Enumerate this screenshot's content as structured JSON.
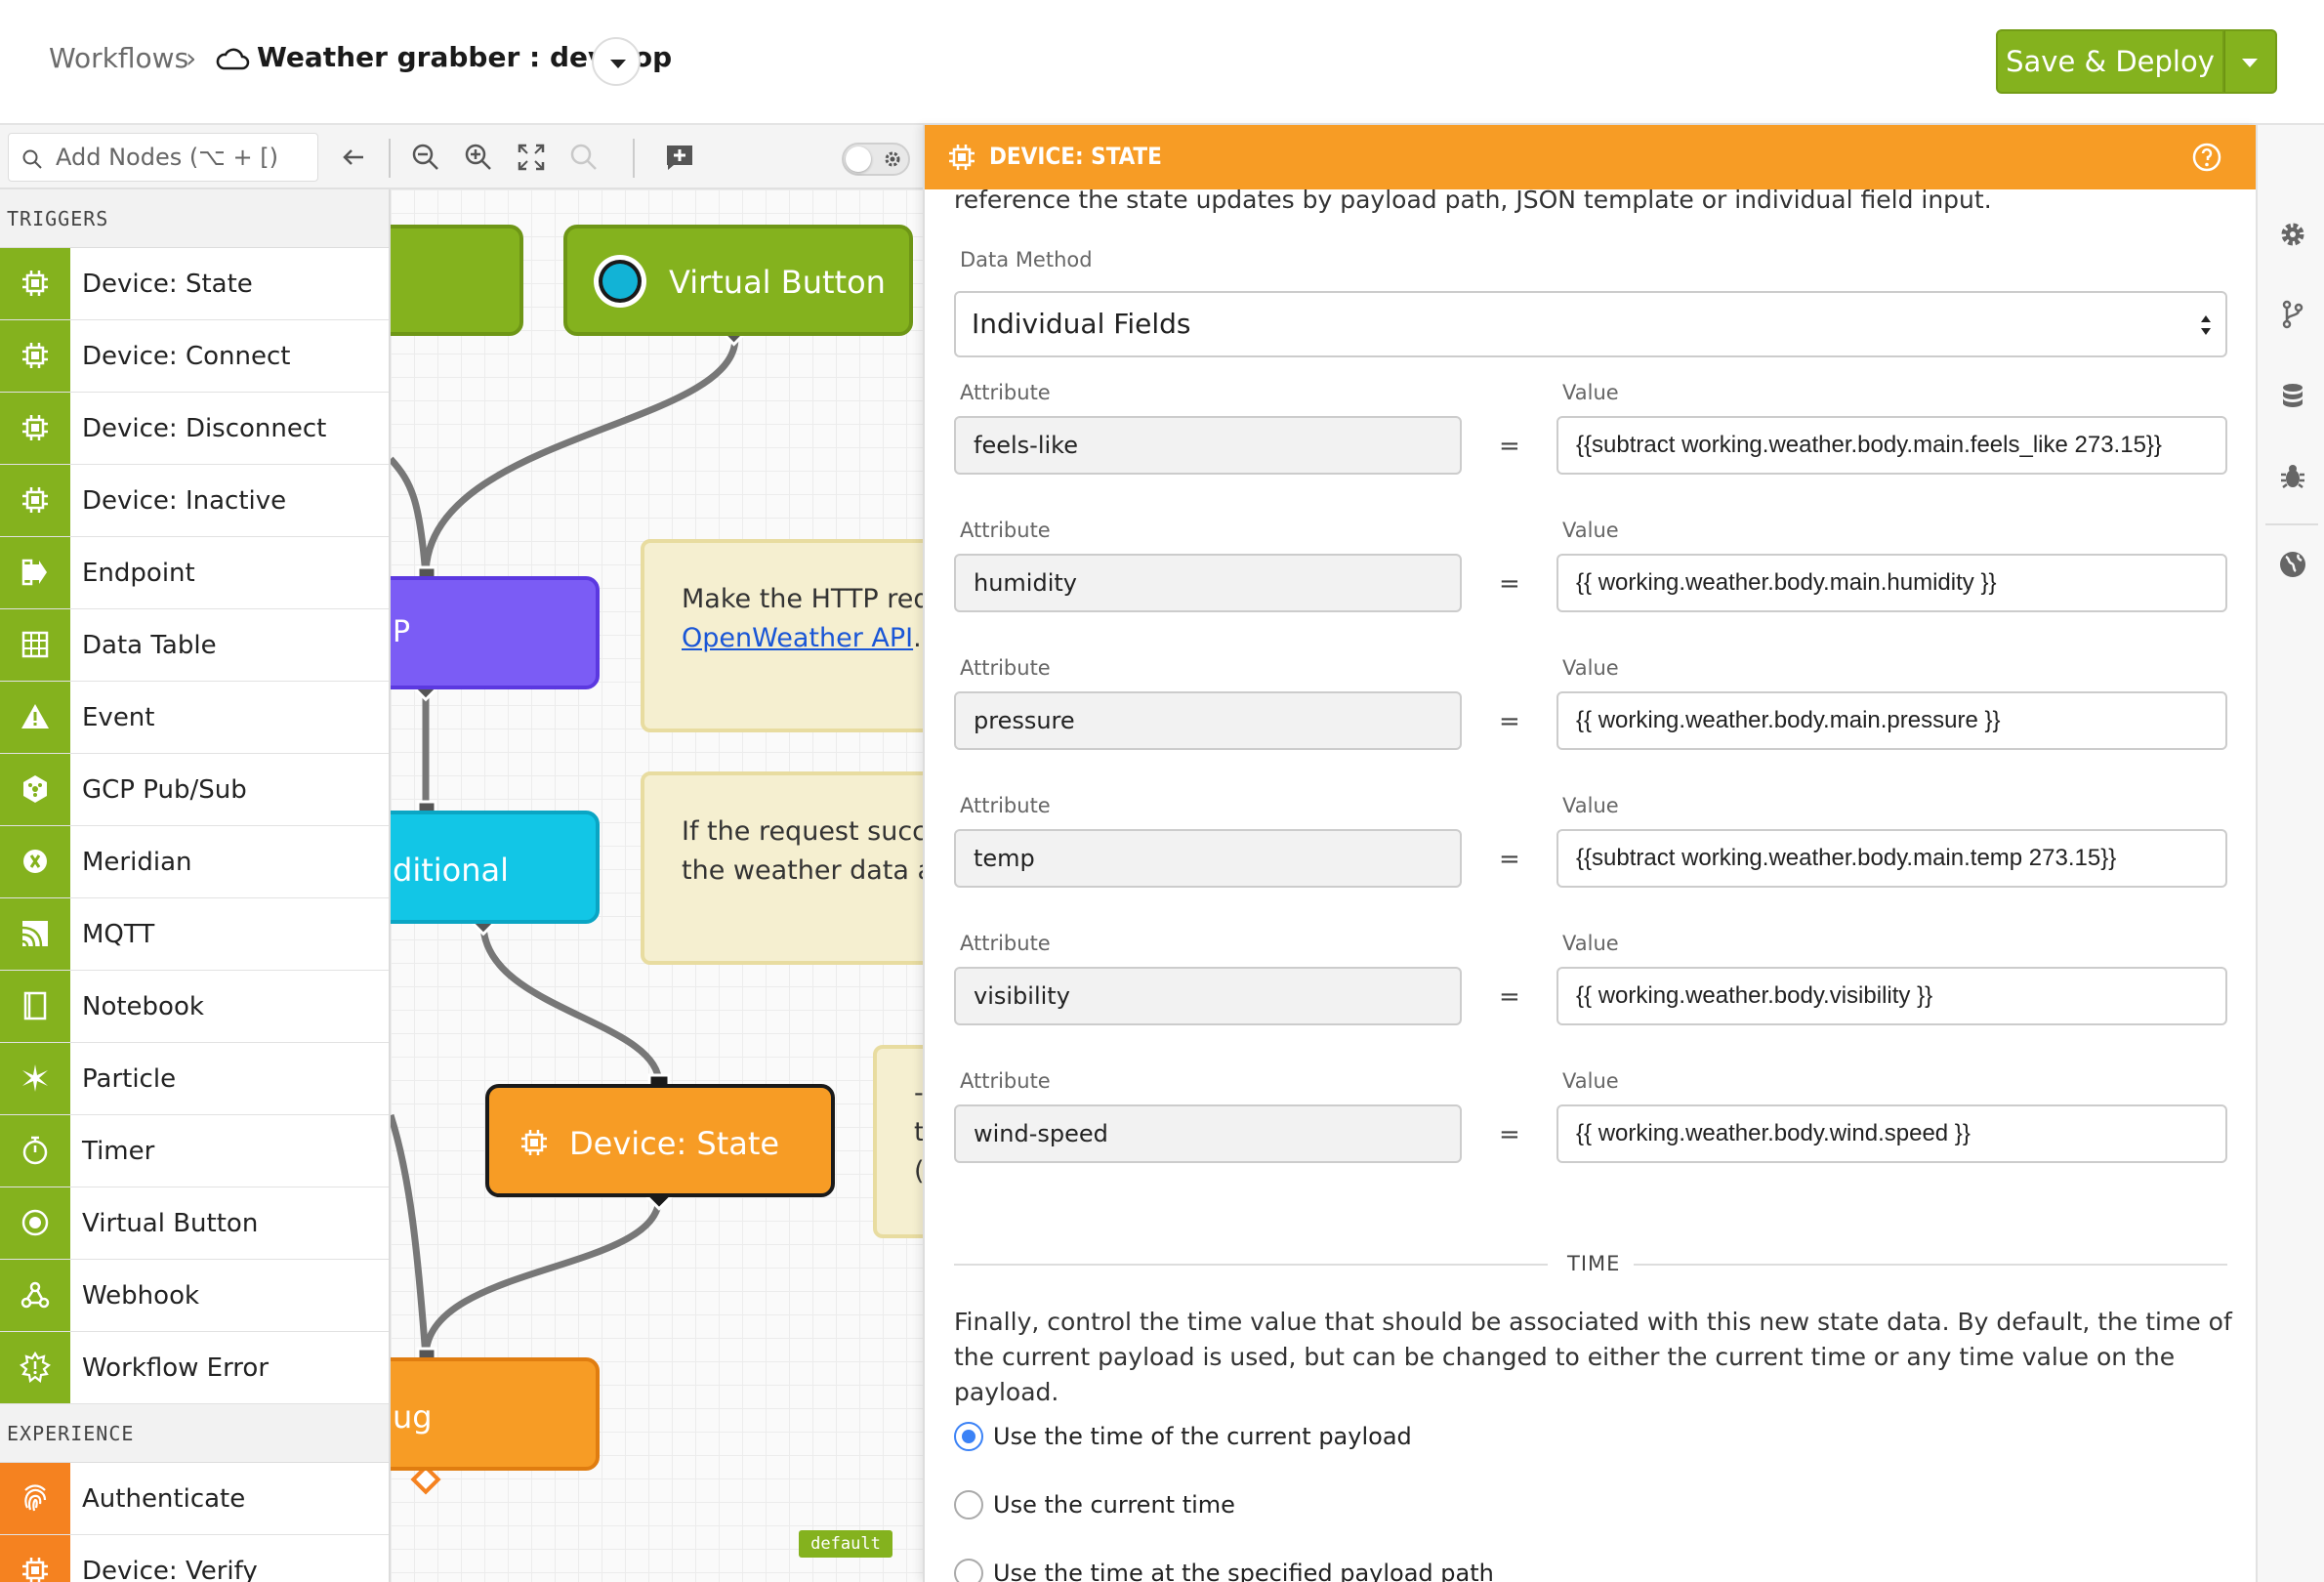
{
  "header": {
    "breadcrumb_root": "Workflows",
    "breadcrumb_sep": "›",
    "workflow_title": "Weather grabber : develop",
    "deploy_label": "Save & Deploy"
  },
  "toolbar": {
    "search_placeholder": "Add Nodes (⌥ + [)"
  },
  "sidebar": {
    "triggers_heading": "TRIGGERS",
    "triggers": [
      {
        "label": "Device: State",
        "icon": "device-chip-icon"
      },
      {
        "label": "Device: Connect",
        "icon": "device-chip-icon"
      },
      {
        "label": "Device: Disconnect",
        "icon": "device-chip-icon"
      },
      {
        "label": "Device: Inactive",
        "icon": "device-chip-icon"
      },
      {
        "label": "Endpoint",
        "icon": "endpoint-icon"
      },
      {
        "label": "Data Table",
        "icon": "table-icon"
      },
      {
        "label": "Event",
        "icon": "warning-icon"
      },
      {
        "label": "GCP Pub/Sub",
        "icon": "hexagon-icon"
      },
      {
        "label": "Meridian",
        "icon": "meridian-icon"
      },
      {
        "label": "MQTT",
        "icon": "mqtt-icon"
      },
      {
        "label": "Notebook",
        "icon": "notebook-icon"
      },
      {
        "label": "Particle",
        "icon": "particle-icon"
      },
      {
        "label": "Timer",
        "icon": "stopwatch-icon"
      },
      {
        "label": "Virtual Button",
        "icon": "target-icon"
      },
      {
        "label": "Webhook",
        "icon": "webhook-icon"
      },
      {
        "label": "Workflow Error",
        "icon": "error-gear-icon"
      }
    ],
    "experience_heading": "EXPERIENCE",
    "experience": [
      {
        "label": "Authenticate",
        "icon": "fingerprint-icon"
      },
      {
        "label": "Device: Verify",
        "icon": "device-chip-icon"
      }
    ]
  },
  "canvas": {
    "virtual_button_label": "Virtual Button",
    "http_node_fragment": "P",
    "conditional_fragment": "ditional",
    "device_state_label": "Device: State",
    "debug_fragment": "ug",
    "note1_line1": "Make the HTTP requ",
    "note1_link": "OpenWeather API",
    "note1_after": ".",
    "note2_line1": "If the request succe",
    "note2_line2": "the weather data as",
    "note3_line1": "-",
    "note3_line2": "t",
    "note3_line3": "(",
    "default_badge": "default"
  },
  "panel": {
    "title": "DEVICE: STATE",
    "intro_text": "reference the state updates by payload path, JSON template or individual field input.",
    "data_method_label": "Data Method",
    "data_method_value": "Individual Fields",
    "attribute_label": "Attribute",
    "value_label": "Value",
    "equals": "=",
    "fields": [
      {
        "attribute": "feels-like",
        "value": "{{subtract working.weather.body.main.feels_like 273.15}}"
      },
      {
        "attribute": "humidity",
        "value": "{{ working.weather.body.main.humidity }}"
      },
      {
        "attribute": "pressure",
        "value": "{{ working.weather.body.main.pressure }}"
      },
      {
        "attribute": "temp",
        "value": "{{subtract working.weather.body.main.temp 273.15}}"
      },
      {
        "attribute": "visibility",
        "value": "{{ working.weather.body.visibility }}"
      },
      {
        "attribute": "wind-speed",
        "value": "{{ working.weather.body.wind.speed }}"
      }
    ],
    "time_heading": "TIME",
    "time_description": "Finally, control the time value that should be associated with this new state data. By default, the time of the current payload is used, but can be changed to either the current time or any time value on the payload.",
    "time_options": [
      {
        "label": "Use the time of the current payload",
        "checked": true
      },
      {
        "label": "Use the current time",
        "checked": false
      },
      {
        "label": "Use the time at the specified payload path",
        "checked": false
      }
    ]
  },
  "colors": {
    "accent_green": "#84b21e",
    "panel_orange": "#f79c25",
    "experience_orange": "#f58220",
    "http_purple": "#7b5cf5",
    "conditional_cyan": "#12c6e6"
  }
}
